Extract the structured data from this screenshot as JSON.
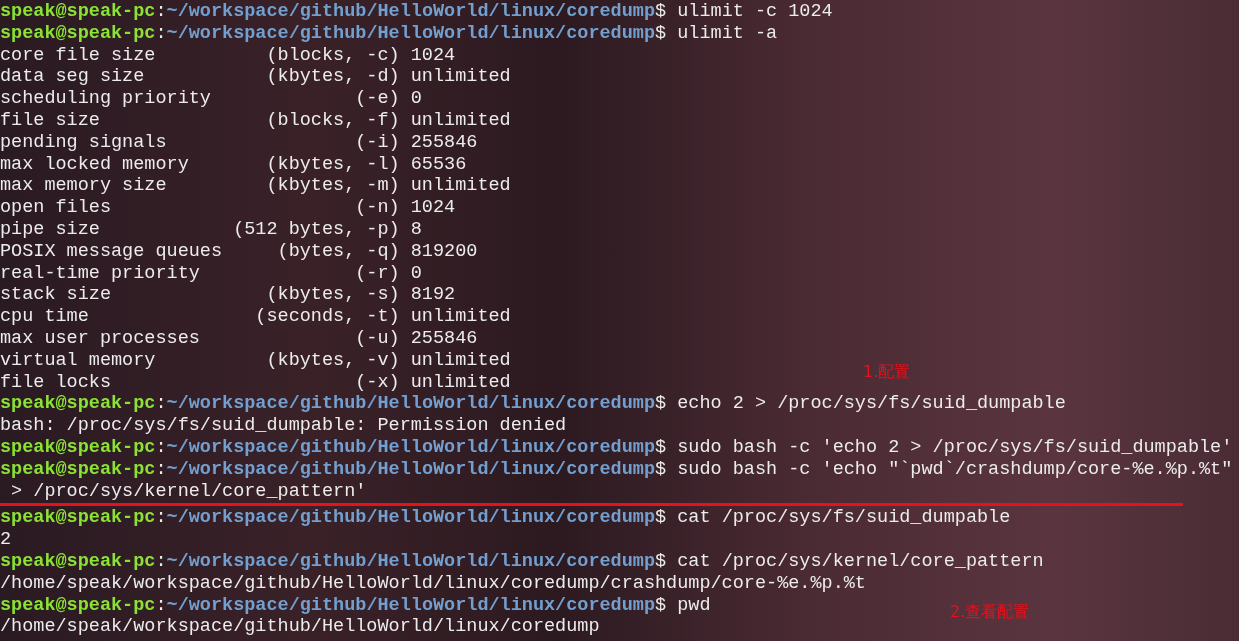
{
  "terminal": {
    "lines": [
      {
        "kind": "prompt",
        "user": "speak@speak-pc",
        "sep": ":",
        "path": "~/workspace/github/HelloWorld/linux/coredump",
        "sign": "$",
        "command": "ulimit -c 1024"
      },
      {
        "kind": "prompt",
        "user": "speak@speak-pc",
        "sep": ":",
        "path": "~/workspace/github/HelloWorld/linux/coredump",
        "sign": "$",
        "command": "ulimit -a"
      },
      {
        "kind": "output",
        "text": "core file size          (blocks, -c) 1024"
      },
      {
        "kind": "output",
        "text": "data seg size           (kbytes, -d) unlimited"
      },
      {
        "kind": "output",
        "text": "scheduling priority             (-e) 0"
      },
      {
        "kind": "output",
        "text": "file size               (blocks, -f) unlimited"
      },
      {
        "kind": "output",
        "text": "pending signals                 (-i) 255846"
      },
      {
        "kind": "output",
        "text": "max locked memory       (kbytes, -l) 65536"
      },
      {
        "kind": "output",
        "text": "max memory size         (kbytes, -m) unlimited"
      },
      {
        "kind": "output",
        "text": "open files                      (-n) 1024"
      },
      {
        "kind": "output",
        "text": "pipe size            (512 bytes, -p) 8"
      },
      {
        "kind": "output",
        "text": "POSIX message queues     (bytes, -q) 819200"
      },
      {
        "kind": "output",
        "text": "real-time priority              (-r) 0"
      },
      {
        "kind": "output",
        "text": "stack size              (kbytes, -s) 8192"
      },
      {
        "kind": "output",
        "text": "cpu time               (seconds, -t) unlimited"
      },
      {
        "kind": "output",
        "text": "max user processes              (-u) 255846"
      },
      {
        "kind": "output",
        "text": "virtual memory          (kbytes, -v) unlimited"
      },
      {
        "kind": "output",
        "text": "file locks                      (-x) unlimited"
      },
      {
        "kind": "prompt",
        "user": "speak@speak-pc",
        "sep": ":",
        "path": "~/workspace/github/HelloWorld/linux/coredump",
        "sign": "$",
        "command": "echo 2 > /proc/sys/fs/suid_dumpable"
      },
      {
        "kind": "output",
        "text": "bash: /proc/sys/fs/suid_dumpable: Permission denied"
      },
      {
        "kind": "prompt",
        "user": "speak@speak-pc",
        "sep": ":",
        "path": "~/workspace/github/HelloWorld/linux/coredump",
        "sign": "$",
        "command": "sudo bash -c 'echo 2 > /proc/sys/fs/suid_dumpable'"
      },
      {
        "kind": "prompt",
        "user": "speak@speak-pc",
        "sep": ":",
        "path": "~/workspace/github/HelloWorld/linux/coredump",
        "sign": "$",
        "command": "sudo bash -c 'echo \"`pwd`/crashdump/core-%e.%p.%t\""
      },
      {
        "kind": "output",
        "text": " > /proc/sys/kernel/core_pattern'"
      },
      {
        "kind": "prompt",
        "user": "speak@speak-pc",
        "sep": ":",
        "path": "~/workspace/github/HelloWorld/linux/coredump",
        "sign": "$",
        "command": "cat /proc/sys/fs/suid_dumpable"
      },
      {
        "kind": "output",
        "text": "2"
      },
      {
        "kind": "prompt",
        "user": "speak@speak-pc",
        "sep": ":",
        "path": "~/workspace/github/HelloWorld/linux/coredump",
        "sign": "$",
        "command": "cat /proc/sys/kernel/core_pattern"
      },
      {
        "kind": "output",
        "text": "/home/speak/workspace/github/HelloWorld/linux/coredump/crashdump/core-%e.%p.%t"
      },
      {
        "kind": "prompt",
        "user": "speak@speak-pc",
        "sep": ":",
        "path": "~/workspace/github/HelloWorld/linux/coredump",
        "sign": "$",
        "command": "pwd"
      },
      {
        "kind": "output",
        "text": "/home/speak/workspace/github/HelloWorld/linux/coredump"
      }
    ]
  },
  "annotations": [
    {
      "text": "1.配置"
    },
    {
      "text": "2.查看配置"
    }
  ]
}
